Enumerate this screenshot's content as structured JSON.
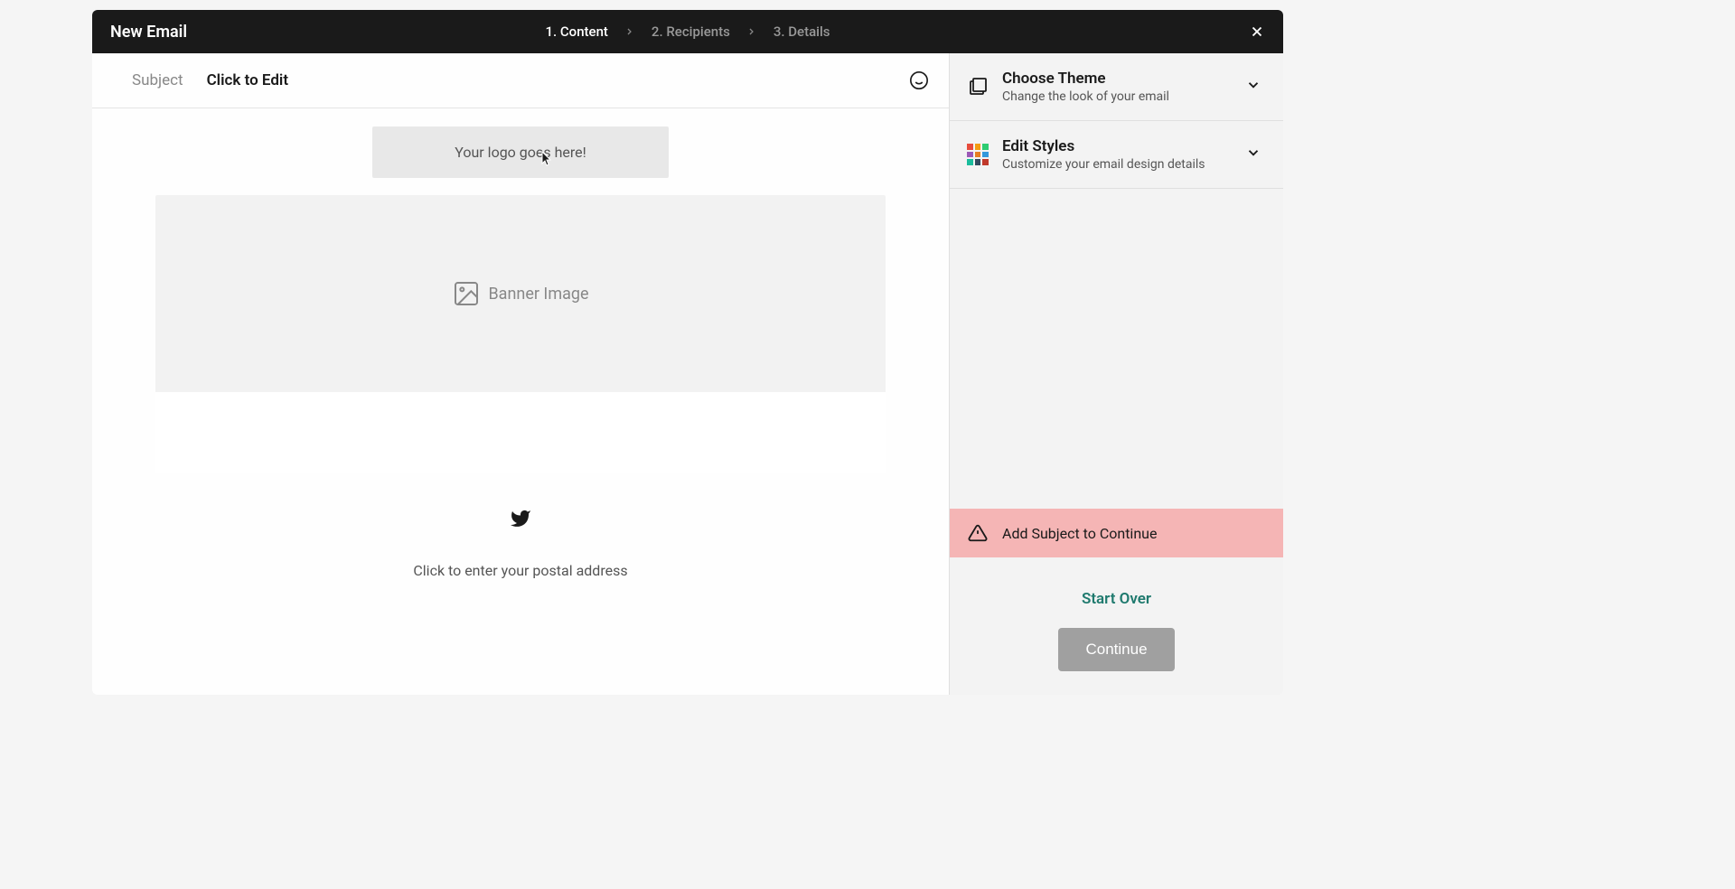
{
  "header": {
    "title": "New Email",
    "steps": [
      {
        "label": "1. Content",
        "active": true
      },
      {
        "label": "2. Recipients",
        "active": false
      },
      {
        "label": "3. Details",
        "active": false
      }
    ]
  },
  "subject": {
    "label": "Subject",
    "value": "Click to Edit"
  },
  "content": {
    "logo_placeholder": "Your logo goes here!",
    "banner_placeholder": "Banner Image",
    "address_placeholder": "Click to enter your postal address"
  },
  "sidebar": {
    "panels": [
      {
        "title": "Choose Theme",
        "desc": "Change the look of your email"
      },
      {
        "title": "Edit Styles",
        "desc": "Customize your email design details"
      }
    ],
    "warning": "Add Subject to Continue",
    "start_over": "Start Over",
    "continue": "Continue"
  },
  "style_grid_colors": [
    "#e74c3c",
    "#f39c12",
    "#2ecc71",
    "#9b59b6",
    "#e67e22",
    "#3498db",
    "#1abc9c",
    "#34495e",
    "#c0392b"
  ]
}
